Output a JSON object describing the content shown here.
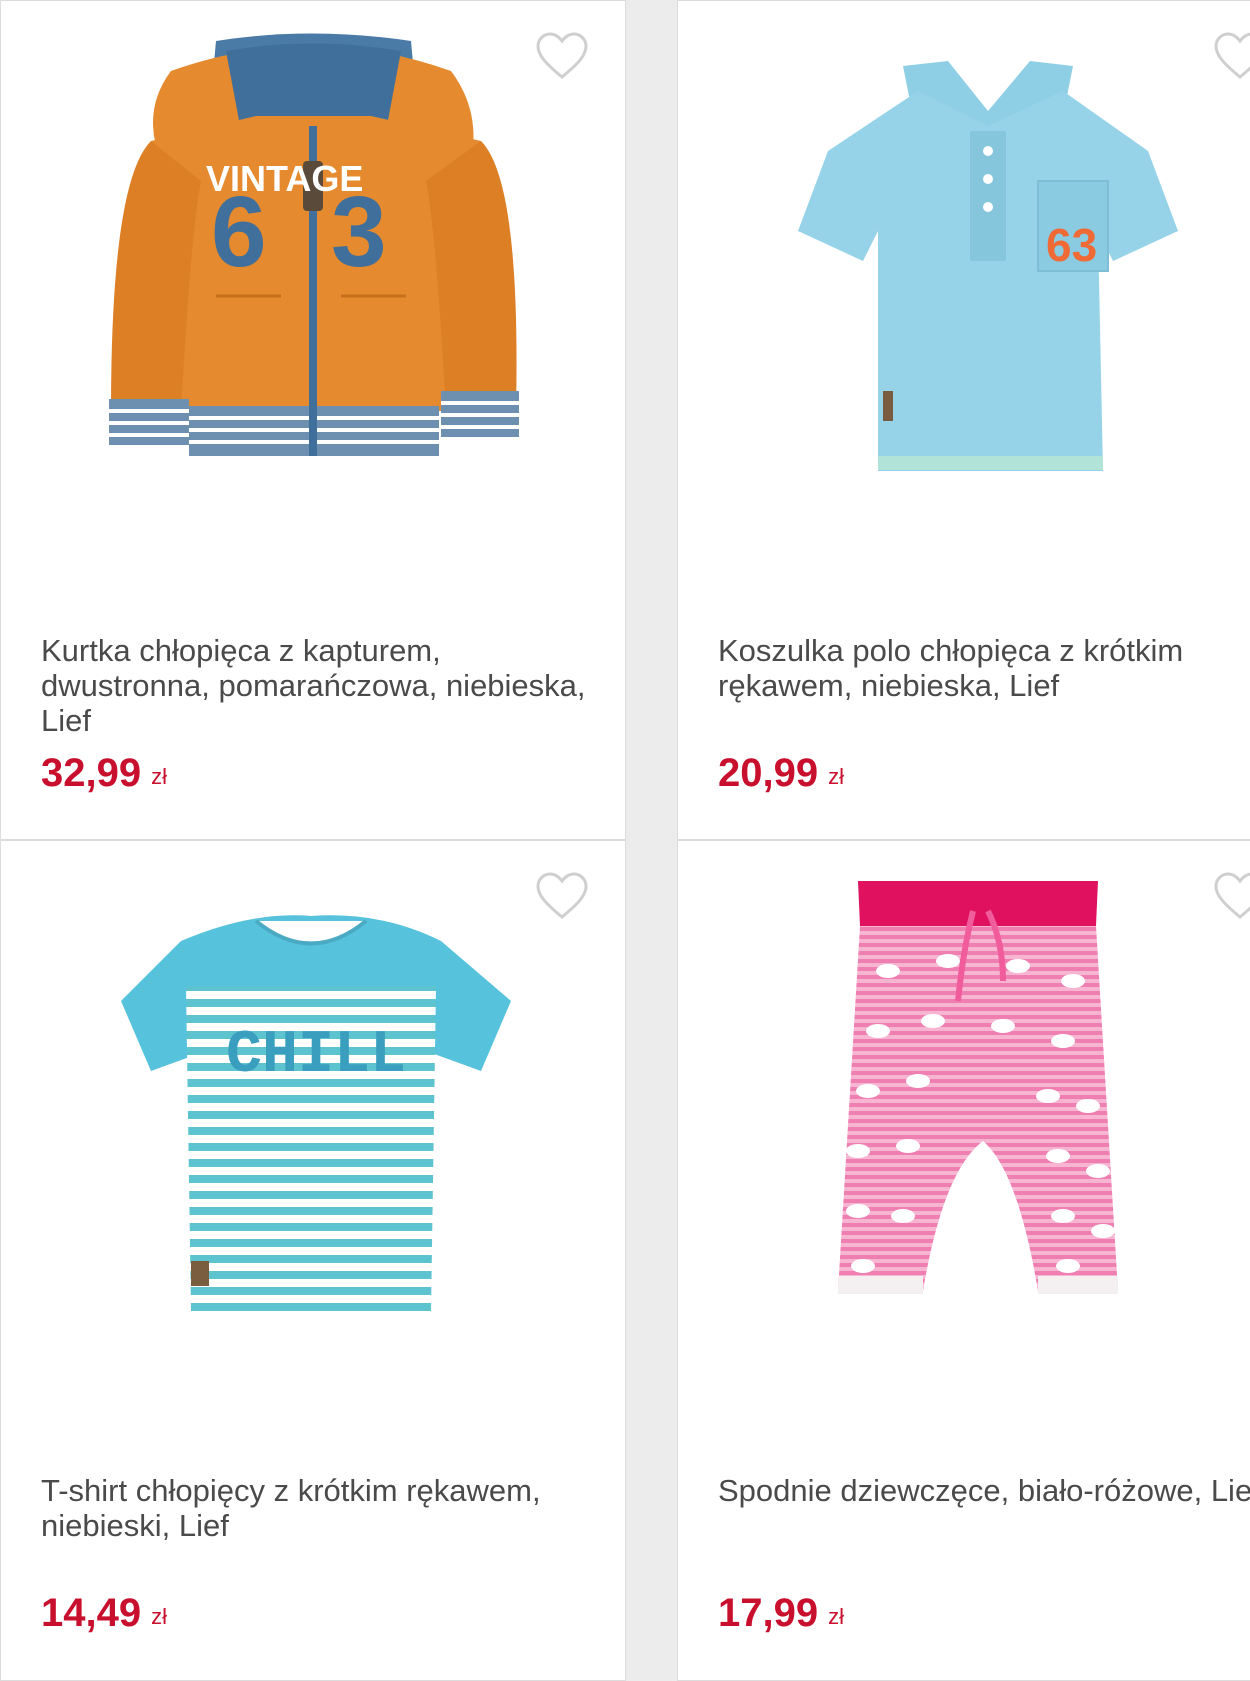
{
  "products": [
    {
      "title": "Kurtka chłopięca z kapturem, dwustronna, pomarańczowa, niebieska, Lief",
      "price": "32,99",
      "currency": "zł",
      "image_icon": "orange-hoodie-image",
      "image_text_1": "VINTAGE",
      "image_text_2": "6",
      "image_text_3": "3"
    },
    {
      "title": "Koszulka polo chłopięca z krótkim rękawem, niebieska, Lief",
      "price": "20,99",
      "currency": "zł",
      "image_icon": "blue-polo-image",
      "image_text_1": "63"
    },
    {
      "title": "T-shirt chłopięcy z krótkim rękawem, niebieski, Lief",
      "price": "14,49",
      "currency": "zł",
      "image_icon": "striped-tshirt-image",
      "image_text_1": "CHILL"
    },
    {
      "title": "Spodnie dziewczęce, biało-różowe, Lief",
      "price": "17,99",
      "currency": "zł",
      "image_icon": "pink-pants-image"
    }
  ],
  "colors": {
    "price": "#c8102e",
    "title": "#4a4a4a",
    "heart": "#cfcfcf"
  }
}
